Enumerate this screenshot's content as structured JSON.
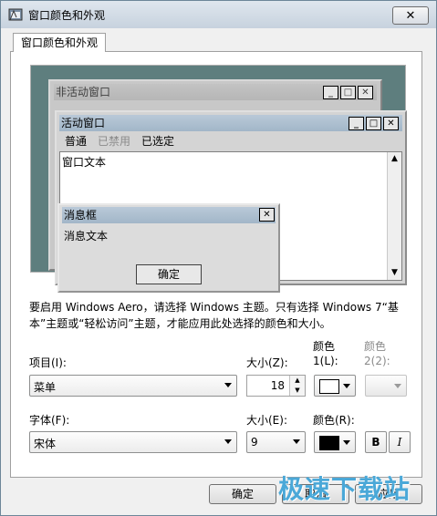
{
  "window": {
    "title": "窗口颜色和外观",
    "close": "✕"
  },
  "tab": {
    "label": "窗口颜色和外观"
  },
  "preview": {
    "inactive_title": "非活动窗口",
    "active_title": "活动窗口",
    "menu": {
      "normal": "普通",
      "disabled": "已禁用",
      "selected": "已选定"
    },
    "window_text": "窗口文本",
    "msgbox_title": "消息框",
    "msgbox_text": "消息文本",
    "ok": "确定",
    "ctrl": {
      "min": "_",
      "max": "□",
      "close": "✕"
    }
  },
  "note": "要启用 Windows Aero，请选择 Windows 主题。只有选择 Windows 7“基本”主题或“轻松访问”主题，才能应用此处选择的颜色和大小。",
  "item": {
    "label": "项目(I):",
    "value": "菜单",
    "size_label": "大小(Z):",
    "size_value": "18",
    "color1_label_a": "颜色",
    "color1_label_b": "1(L):",
    "color2_label_a": "颜色",
    "color2_label_b": "2(2):",
    "color1": "#ffffff"
  },
  "font": {
    "label": "字体(F):",
    "value": "宋体",
    "size_label": "大小(E):",
    "size_value": "9",
    "color_label": "颜色(R):",
    "color": "#000000",
    "bold": "B",
    "italic": "I"
  },
  "buttons": {
    "ok": "确定",
    "cancel": "取消",
    "apply": "应用"
  },
  "watermark": "极速下载站"
}
